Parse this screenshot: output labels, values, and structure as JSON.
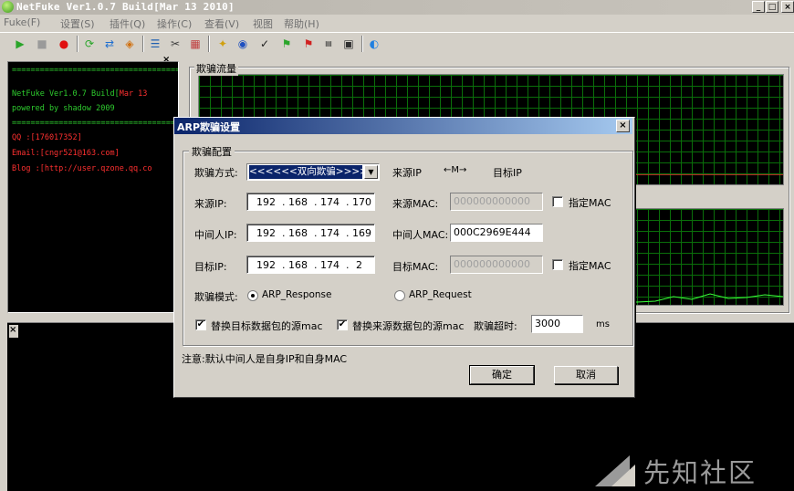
{
  "window": {
    "title": "NetFuke Ver1.0.7 Build[Mar 13 2010]",
    "minimize": "_",
    "maximize": "□",
    "close": "×"
  },
  "menu": [
    "Fuke(F)",
    "设置(S)",
    "插件(Q)",
    "操作(C)",
    "查看(V)",
    "视图",
    "帮助(H)"
  ],
  "console": {
    "close": "×",
    "lines": [
      {
        "text": "====================================",
        "color": "#2ecc2e"
      },
      {
        "text": "NetFuke Ver1.0.7 Build[",
        "color": "#2ecc2e",
        "suffix": "Mar 13",
        "suffix_color": "#ff3030"
      },
      {
        "text": "powered by shadow 2009",
        "color": "#2ecc2e"
      },
      {
        "text": "====================================",
        "color": "#2ecc2e"
      },
      {
        "text": "QQ   :[176017352]",
        "color": "#ff3030"
      },
      {
        "text": "Email:[cngr521@163.com]",
        "color": "#ff3030"
      },
      {
        "text": "Blog :[http://user.qzone.qq.co",
        "color": "#ff3030"
      }
    ]
  },
  "traffic": {
    "title": "欺骗流量"
  },
  "bottom": {
    "close": "×"
  },
  "dialog": {
    "title": "ARP欺骗设置",
    "close": "×",
    "group_title": "欺骗配置",
    "method_label": "欺骗方式:",
    "method_value": "<<<<<<双向欺骗>>>>>>",
    "flow": {
      "source": "来源IP",
      "arrow": "←M→",
      "target": "目标IP"
    },
    "rows": [
      {
        "label": "来源IP:",
        "ip": [
          "192",
          "168",
          "174",
          "170"
        ],
        "mac_label": "来源MAC:",
        "mac": "000000000000",
        "mac_enabled": false,
        "has_checkbox": true,
        "checkbox_label": "指定MAC"
      },
      {
        "label": "中间人IP:",
        "ip": [
          "192",
          "168",
          "174",
          "169"
        ],
        "mac_label": "中间人MAC:",
        "mac": "000C2969E444",
        "mac_enabled": true,
        "has_checkbox": false
      },
      {
        "label": "目标IP:",
        "ip": [
          "192",
          "168",
          "174",
          "2"
        ],
        "mac_label": "目标MAC:",
        "mac": "000000000000",
        "mac_enabled": false,
        "has_checkbox": true,
        "checkbox_label": "指定MAC"
      }
    ],
    "mode_label": "欺骗模式:",
    "mode_options": [
      {
        "label": "ARP_Response",
        "selected": true
      },
      {
        "label": "ARP_Request",
        "selected": false
      }
    ],
    "replace_target_label": "替换目标数据包的源mac",
    "replace_source_label": "替换来源数据包的源mac",
    "replace_target_checked": true,
    "replace_source_checked": true,
    "timeout_label": "欺骗超时:",
    "timeout_value": "3000",
    "timeout_unit": "ms",
    "note": "注意:默认中间人是自身IP和自身MAC",
    "ok_label": "确定",
    "cancel_label": "取消"
  },
  "watermark": {
    "text": "先知社区"
  }
}
